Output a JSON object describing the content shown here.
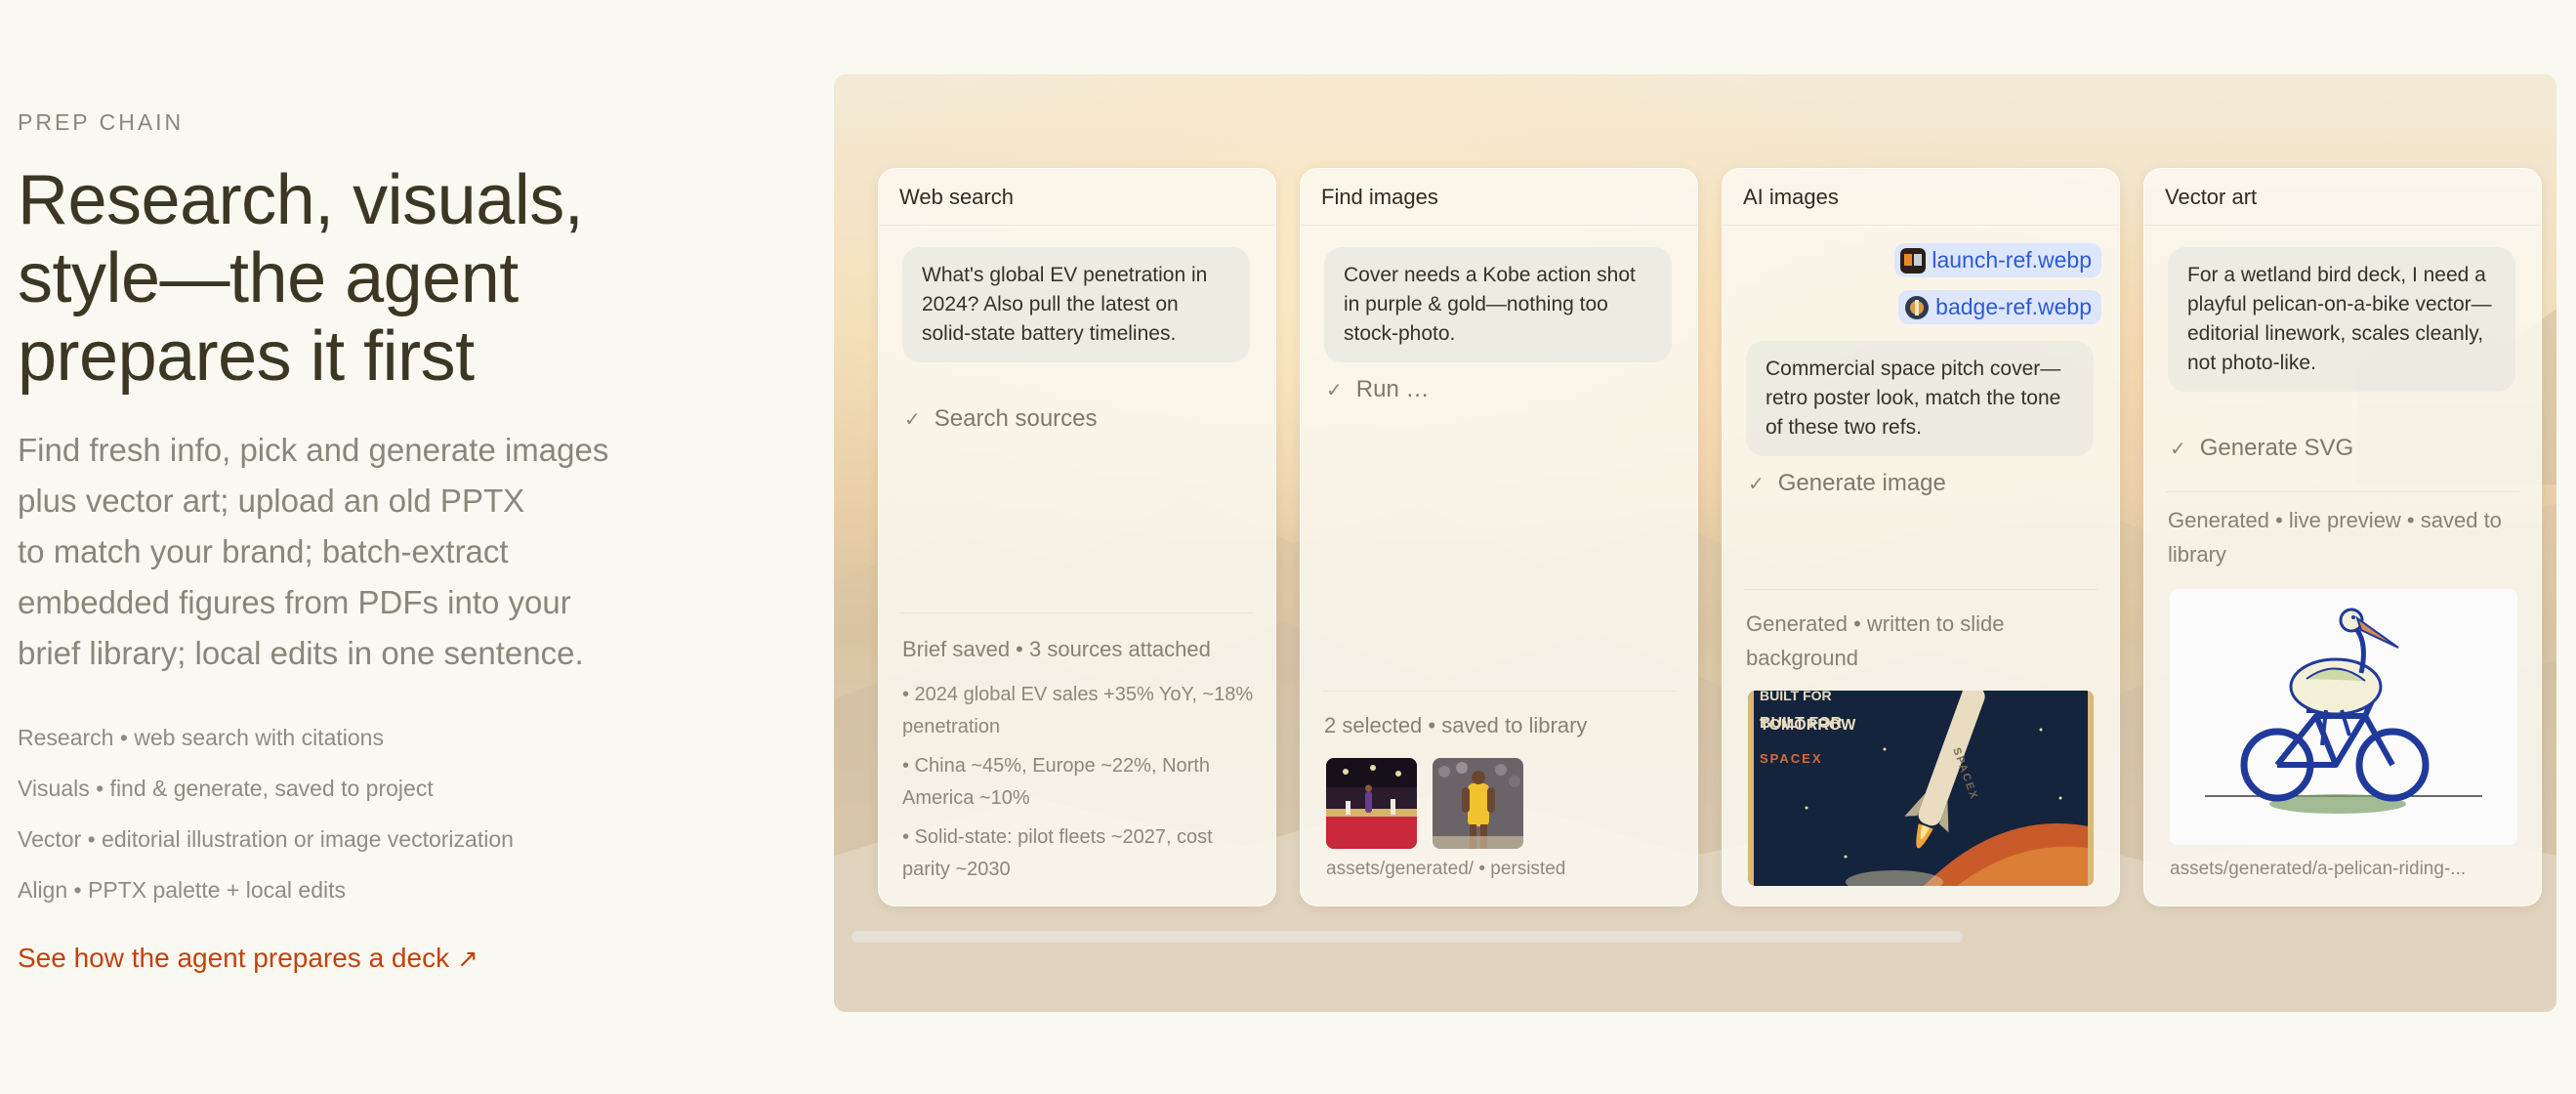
{
  "left": {
    "eyebrow": "PREP CHAIN",
    "headline": [
      "Research, visuals,",
      "style—the agent",
      "prepares it first"
    ],
    "lead": [
      "Find fresh info, pick and generate images",
      "plus vector art; upload an old PPTX",
      "to match your brand; batch-extract",
      "embedded figures from PDFs into your",
      "brief library; local edits in one sentence."
    ],
    "features": [
      "Research • web search with citations",
      "Visuals • find & generate, saved to project",
      "Vector • editorial illustration or image vectorization",
      "Align • PPTX palette + local edits"
    ],
    "cta": "See how the agent prepares a deck",
    "cta_icon": "arrow-up-right-icon"
  },
  "cards": {
    "web": {
      "title": "Web search",
      "prompt": "What's global EV penetration in 2024? Also pull the latest on solid-state battery timelines.",
      "step": "Search sources",
      "meta": "Brief saved • 3 sources attached",
      "bullets": [
        "• 2024 global EV sales +35% YoY, ~18% penetration",
        "• China ~45%, Europe ~22%, North America ~10%",
        "• Solid-state: pilot fleets ~2027, cost parity ~2030"
      ]
    },
    "find": {
      "title": "Find images",
      "prompt": "Cover needs a Kobe action shot in purple & gold—nothing too stock-photo.",
      "step": "Run …",
      "meta": "2 selected • saved to library",
      "path": "assets/generated/ • persisted"
    },
    "ai": {
      "title": "AI images",
      "chips": [
        "launch-ref.webp",
        "badge-ref.webp"
      ],
      "prompt": "Commercial space pitch cover—retro poster look, match the tone of these two refs.",
      "step": "Generate image",
      "meta": "Generated • written to slide background",
      "poster_text": [
        "BUILT FOR",
        "TOMORROW",
        "SPACEX",
        "SPACEX"
      ]
    },
    "vector": {
      "title": "Vector art",
      "prompt": "For a wetland bird deck, I need a playful pelican-on-a-bike vector—editorial linework, scales cleanly, not photo-like.",
      "step": "Generate SVG",
      "meta": "Generated • live preview • saved to library",
      "path": "assets/generated/a-pelican-riding-..."
    }
  },
  "colors": {
    "accent": "#c2410c",
    "chip_bg": "#dde6fa",
    "chip_text": "#2c5bd6",
    "page_bg": "#faf9f1"
  }
}
